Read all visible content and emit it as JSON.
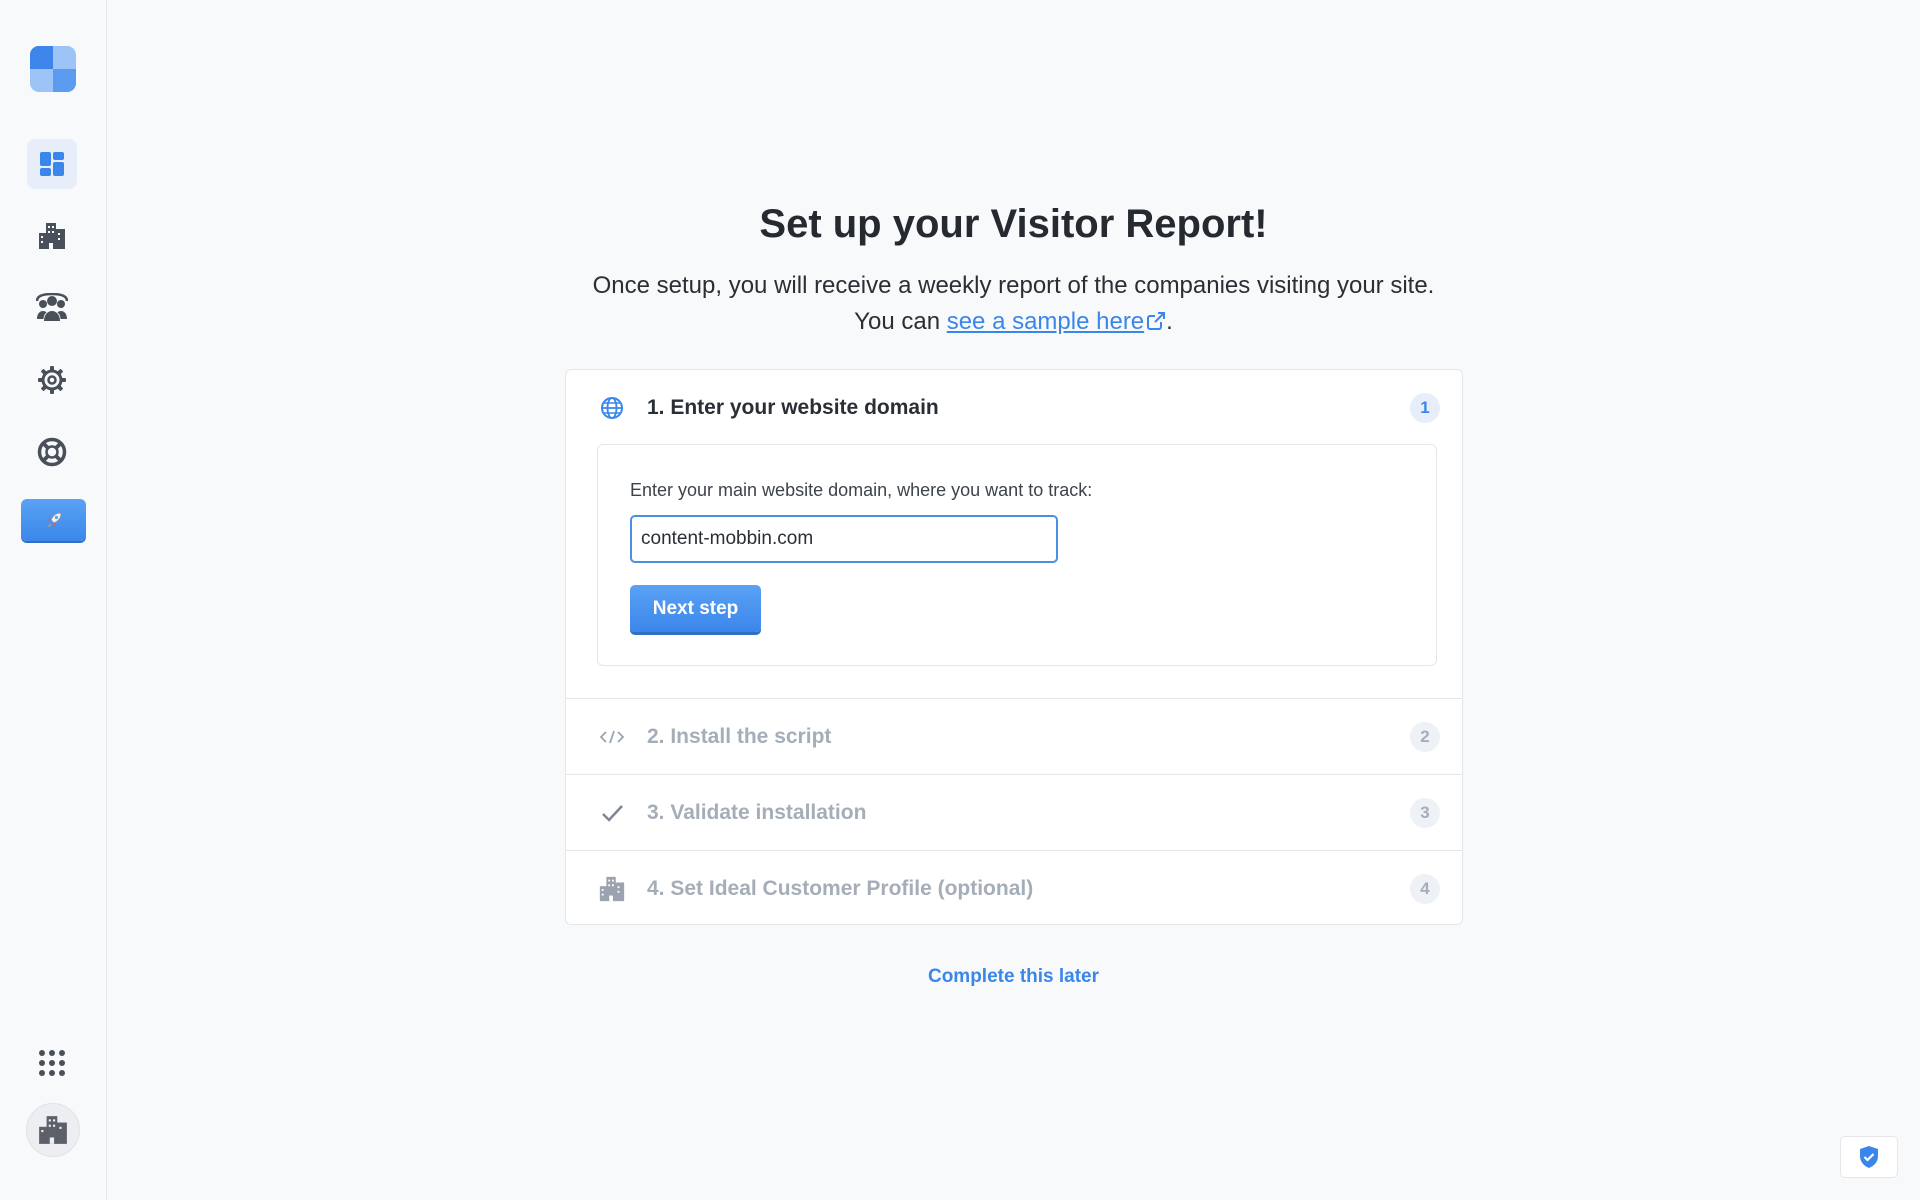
{
  "sidebar": {
    "logo": "app-logo",
    "items": [
      {
        "icon": "dashboard-icon",
        "active": true
      },
      {
        "icon": "companies-icon"
      },
      {
        "icon": "people-icon"
      },
      {
        "icon": "settings-icon"
      },
      {
        "icon": "help-icon"
      },
      {
        "icon": "rocket-icon"
      }
    ],
    "apps_icon": "grid-icon",
    "avatar_icon": "company-icon"
  },
  "main": {
    "title": "Set up your Visitor Report!",
    "subtitle_line1": "Once setup, you will receive a weekly report of the companies visiting your site.",
    "subtitle_prefix": "You can ",
    "sample_link": "see a sample here",
    "subtitle_suffix": ".",
    "steps": [
      {
        "label": "1. Enter your website domain",
        "number": "1",
        "icon": "globe-icon",
        "active": true
      },
      {
        "label": "2. Install the script",
        "number": "2",
        "icon": "code-icon",
        "active": false
      },
      {
        "label": "3. Validate installation",
        "number": "3",
        "icon": "check-icon",
        "active": false
      },
      {
        "label": "4. Set Ideal Customer Profile (optional)",
        "number": "4",
        "icon": "building-icon",
        "active": false
      }
    ],
    "domain_field": {
      "label": "Enter your main website domain, where you want to track:",
      "value": "content-mobbin.com"
    },
    "next_button": "Next step",
    "later_link": "Complete this later"
  },
  "colors": {
    "accent": "#3b86ea",
    "muted_text": "#a5adb8",
    "background": "#f8f9fb"
  }
}
